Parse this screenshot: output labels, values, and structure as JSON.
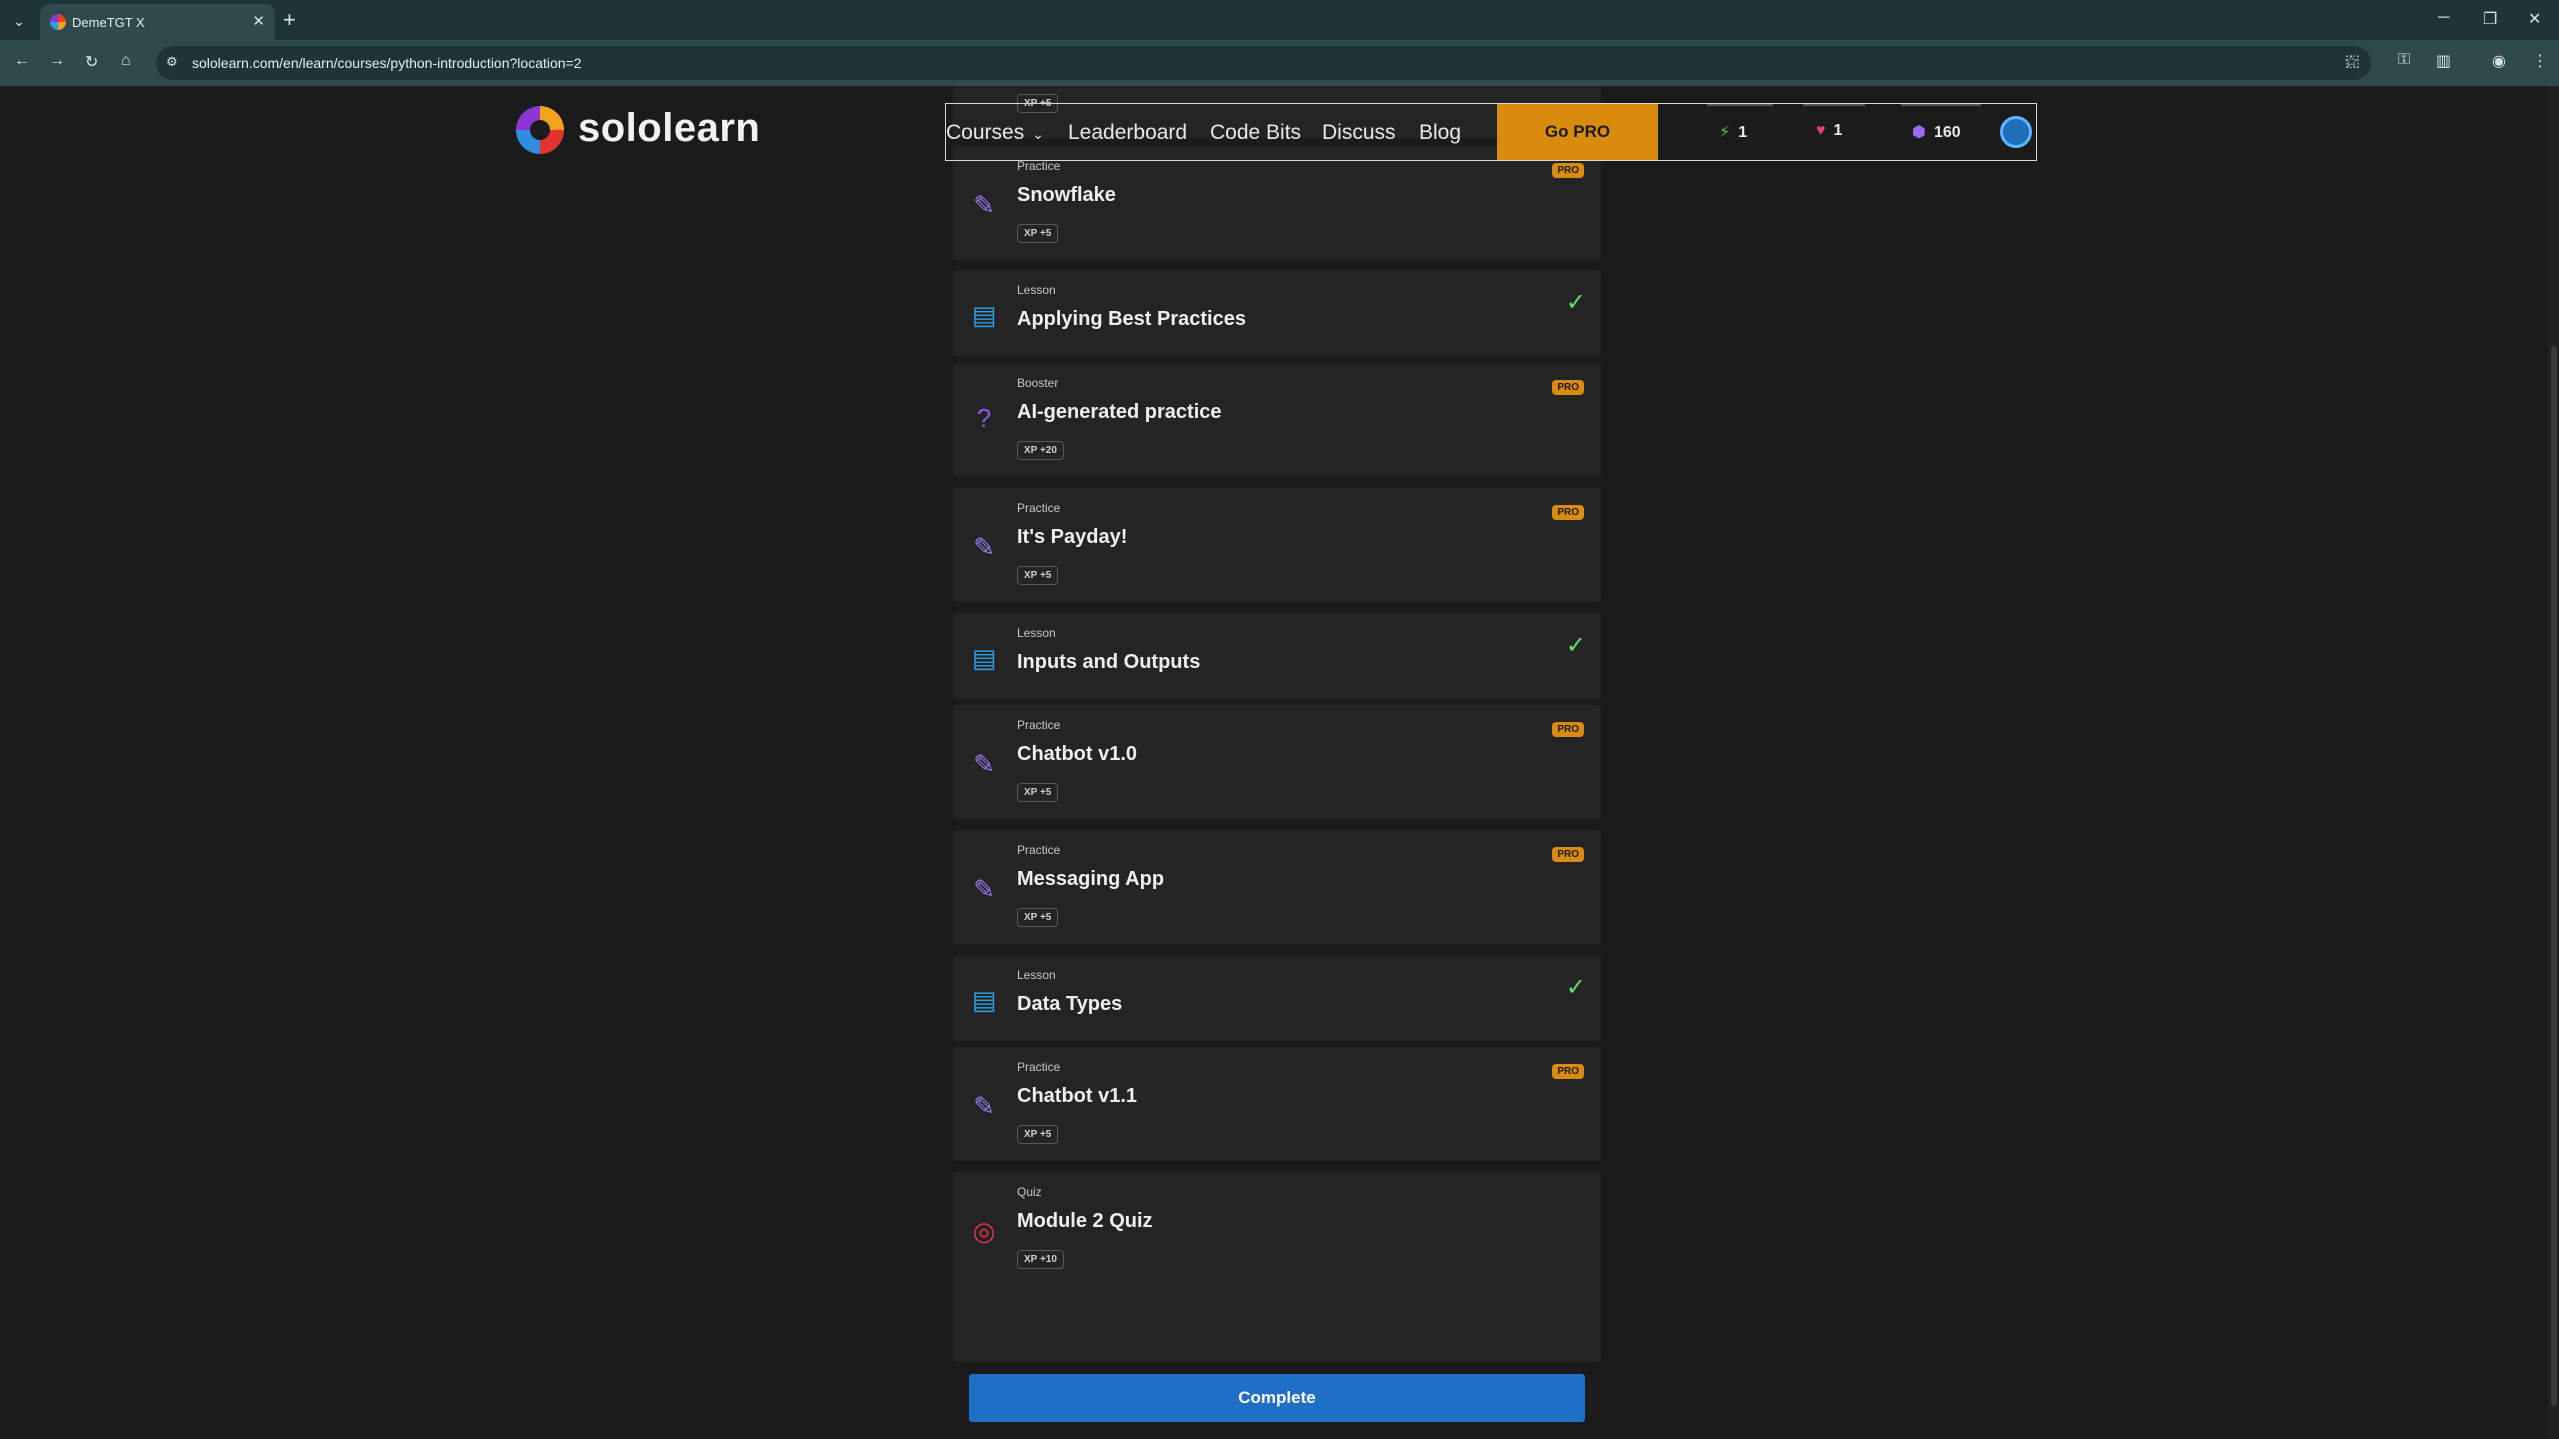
{
  "browser": {
    "tab_title": "DemeTGT X",
    "tab_close": "✕",
    "new_tab": "+",
    "tab_list": "⌄",
    "url": "sololearn.com/en/learn/courses/python-introduction?location=2",
    "nav": {
      "back": "←",
      "forward": "→",
      "reload": "↻",
      "home": "⌂"
    },
    "window": {
      "minimize": "─",
      "restore": "❐",
      "close": "✕"
    },
    "star": "☆",
    "site_info": "⚙",
    "extensions": [
      "⬚",
      "⚿",
      "▥",
      "◉",
      "⋮"
    ]
  },
  "header": {
    "logo_text": "sololearn",
    "nav": {
      "courses": "Courses",
      "courses_caret": "⌄",
      "leaderboard": "Leaderboard",
      "code_bits": "Code Bits",
      "discuss": "Discuss",
      "blog": "Blog"
    },
    "go_pro": "Go PRO",
    "stats": {
      "streak": "1",
      "hearts": "1",
      "gems": "160",
      "streak_icon": "⚡",
      "heart_icon": "♥",
      "gem_icon": "⬢"
    }
  },
  "items": [
    {
      "type": "",
      "title": "",
      "xp": "XP +5",
      "pro": false,
      "done": false,
      "icon": ""
    },
    {
      "type": "Practice",
      "title": "Snowflake",
      "xp": "XP +5",
      "pro": true,
      "done": false,
      "icon": "✎"
    },
    {
      "type": "Lesson",
      "title": "Applying Best Practices",
      "xp": "",
      "pro": false,
      "done": true,
      "icon": "▤"
    },
    {
      "type": "Booster",
      "title": "AI-generated practice",
      "xp": "XP +20",
      "pro": true,
      "done": false,
      "icon": "?"
    },
    {
      "type": "Practice",
      "title": "It's Payday!",
      "xp": "XP +5",
      "pro": true,
      "done": false,
      "icon": "✎"
    },
    {
      "type": "Lesson",
      "title": "Inputs and Outputs",
      "xp": "",
      "pro": false,
      "done": true,
      "icon": "▤"
    },
    {
      "type": "Practice",
      "title": "Chatbot v1.0",
      "xp": "XP +5",
      "pro": true,
      "done": false,
      "icon": "✎"
    },
    {
      "type": "Practice",
      "title": "Messaging App",
      "xp": "XP +5",
      "pro": true,
      "done": false,
      "icon": "✎"
    },
    {
      "type": "Lesson",
      "title": "Data Types",
      "xp": "",
      "pro": false,
      "done": true,
      "icon": "▤"
    },
    {
      "type": "Practice",
      "title": "Chatbot v1.1",
      "xp": "XP +5",
      "pro": true,
      "done": false,
      "icon": "✎"
    },
    {
      "type": "Quiz",
      "title": "Module 2 Quiz",
      "xp": "XP +10",
      "pro": false,
      "done": false,
      "icon": "◎"
    }
  ],
  "labels": {
    "pro_badge": "PRO",
    "check": "✓"
  },
  "complete_label": "Complete",
  "colors": {
    "accent_pro": "#d98b0e",
    "complete_button": "#1e70c6",
    "check_green": "#5ee06b",
    "practice": "#9a7bf0",
    "lesson": "#2f9de6",
    "quiz": "#e0334c"
  }
}
